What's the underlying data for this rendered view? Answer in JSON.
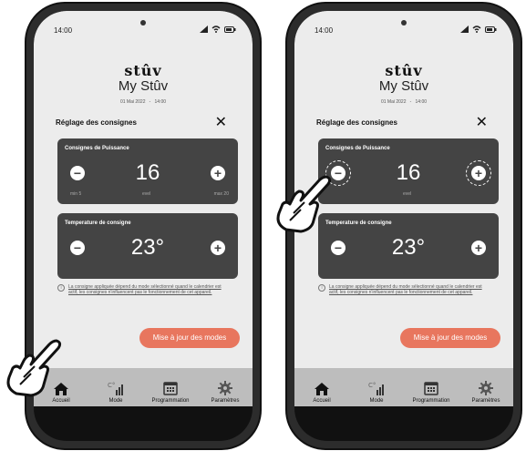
{
  "phones": [
    {
      "status": {
        "time": "14:00"
      },
      "header": {
        "brand": "stûv",
        "title": "My Stûv",
        "date": "01 Mai 2022",
        "time": "14:00"
      },
      "section_title": "Réglage des consignes",
      "power": {
        "title": "Consignes de Puissance",
        "value": "16",
        "min_label": "min 5",
        "level_label": "evel",
        "max_label": "max 20"
      },
      "temperature": {
        "title": "Temperature de consigne",
        "value": "23°"
      },
      "info_text": "La consigne appliquée dépend du mode sélectionné quand le calendrier est actif, les consignes n'influencent pas le fonctionnement de cet appareil.",
      "update_button": "Mise à jour des modes",
      "nav": [
        {
          "label": "Accueil",
          "icon": "home-icon"
        },
        {
          "label": "Mode",
          "icon": "mode-icon"
        },
        {
          "label": "Programmation",
          "icon": "calendar-icon"
        },
        {
          "label": "Paramètres",
          "icon": "gear-icon"
        }
      ]
    },
    {
      "status": {
        "time": "14:00"
      },
      "header": {
        "brand": "stûv",
        "title": "My Stûv",
        "date": "01 Mai 2022",
        "time": "14:00"
      },
      "section_title": "Réglage des consignes",
      "power": {
        "title": "Consignes de Puissance",
        "value": "16",
        "min_label": "",
        "level_label": "evel",
        "max_label": ""
      },
      "temperature": {
        "title": "Temperature de consigne",
        "value": "23°"
      },
      "info_text": "La consigne appliquée dépend du mode sélectionné quand le calendrier est actif, les consignes n'influencent pas le fonctionnement de cet appareil.",
      "update_button": "Mise à jour des modes",
      "nav": [
        {
          "label": "Accueil",
          "icon": "home-icon"
        },
        {
          "label": "Mode",
          "icon": "mode-icon"
        },
        {
          "label": "Programmation",
          "icon": "calendar-icon"
        },
        {
          "label": "Paramètres",
          "icon": "gear-icon"
        }
      ]
    }
  ],
  "colors": {
    "accent": "#e8765e",
    "card": "#444444",
    "nav": "#bdbdbd",
    "screen": "#ececec"
  }
}
